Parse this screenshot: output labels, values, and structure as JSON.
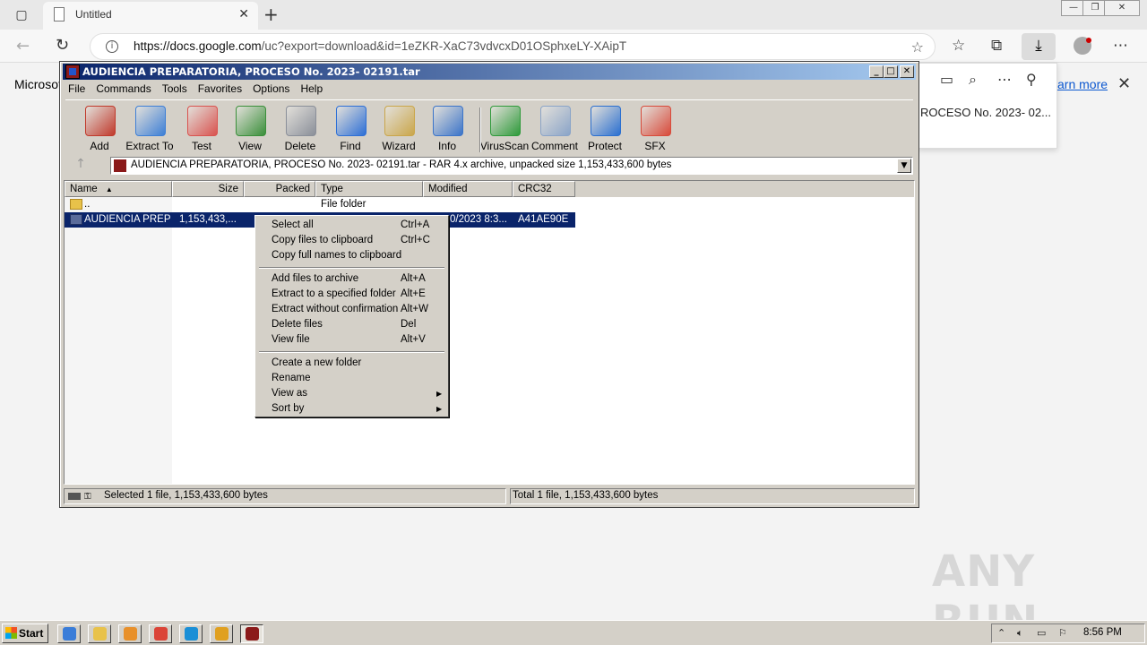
{
  "browser": {
    "tab_title": "Untitled",
    "url_host": "https://docs.google.com",
    "url_path": "/uc?export=download&id=1eZKR-XaC73vdvcxD01OSphxeLY-XAipT",
    "page_left_text": "Microsof",
    "flyout_file_text": "ROCESO No. 2023- 02...",
    "learn_more": "arn more"
  },
  "winrar": {
    "title": "AUDIENCIA PREPARATORIA, PROCESO No. 2023- 02191.tar",
    "menu": [
      "File",
      "Commands",
      "Tools",
      "Favorites",
      "Options",
      "Help"
    ],
    "toolbar": [
      {
        "label": "Add",
        "icon": "add-archive-icon",
        "color": "#c0392b"
      },
      {
        "label": "Extract To",
        "icon": "extract-folder-icon",
        "color": "#3d7fd6"
      },
      {
        "label": "Test",
        "icon": "test-clipboard-icon",
        "color": "#d9534f"
      },
      {
        "label": "View",
        "icon": "view-book-icon",
        "color": "#3a8f3a"
      },
      {
        "label": "Delete",
        "icon": "trash-icon",
        "color": "#8a8f99"
      },
      {
        "label": "Find",
        "icon": "magnifier-icon",
        "color": "#2d6fd6"
      },
      {
        "label": "Wizard",
        "icon": "wand-icon",
        "color": "#caa64a"
      },
      {
        "label": "Info",
        "icon": "info-icon",
        "color": "#3b74c9"
      },
      {
        "label": "VirusScan",
        "icon": "bug-icon",
        "color": "#2e9a3a"
      },
      {
        "label": "Comment",
        "icon": "comment-icon",
        "color": "#8aa4c8"
      },
      {
        "label": "Protect",
        "icon": "shield-icon",
        "color": "#2a6fd0"
      },
      {
        "label": "SFX",
        "icon": "sfx-box-icon",
        "color": "#d84a3a"
      }
    ],
    "path_text": "AUDIENCIA PREPARATORIA, PROCESO No. 2023- 02191.tar - RAR 4.x archive, unpacked size 1,153,433,600 bytes",
    "columns": [
      "Name",
      "Size",
      "Packed",
      "Type",
      "Modified",
      "CRC32"
    ],
    "rows": [
      {
        "name": "..",
        "size": "",
        "packed": "",
        "type": "File folder",
        "modified": "",
        "crc": ""
      },
      {
        "name": "AUDIENCIA PREP...",
        "size": "1,153,433,...",
        "packed": "",
        "type": "",
        "modified": "0/2023 8:3...",
        "crc": "A41AE90E"
      }
    ],
    "status_left": "Selected 1 file, 1,153,433,600 bytes",
    "status_right": "Total 1 file, 1,153,433,600 bytes"
  },
  "context_menu": {
    "group1": [
      {
        "label": "Select all",
        "accel": "Ctrl+A"
      },
      {
        "label": "Copy files to clipboard",
        "accel": "Ctrl+C"
      },
      {
        "label": "Copy full names to clipboard",
        "accel": ""
      }
    ],
    "group2": [
      {
        "label": "Add files to archive",
        "accel": "Alt+A"
      },
      {
        "label": "Extract to a specified folder",
        "accel": "Alt+E"
      },
      {
        "label": "Extract without confirmation",
        "accel": "Alt+W"
      },
      {
        "label": "Delete files",
        "accel": "Del"
      },
      {
        "label": "View file",
        "accel": "Alt+V"
      }
    ],
    "group3": [
      {
        "label": "Create a new folder",
        "accel": ""
      },
      {
        "label": "Rename",
        "accel": ""
      },
      {
        "label": "View as",
        "accel": ""
      },
      {
        "label": "Sort by",
        "accel": ""
      }
    ]
  },
  "taskbar": {
    "start_label": "Start",
    "clock": "8:56 PM",
    "apps": [
      {
        "name": "ie-icon",
        "color": "#3b7dd8"
      },
      {
        "name": "explorer-icon",
        "color": "#e8c24a"
      },
      {
        "name": "media-player-icon",
        "color": "#e8902a"
      },
      {
        "name": "chrome-icon",
        "color": "#db4437"
      },
      {
        "name": "edge-icon",
        "color": "#1b8fd6"
      },
      {
        "name": "office-icon",
        "color": "#e0a020"
      },
      {
        "name": "winrar-icon",
        "color": "#8b1a1a"
      }
    ]
  },
  "watermark": "ANY RUN"
}
